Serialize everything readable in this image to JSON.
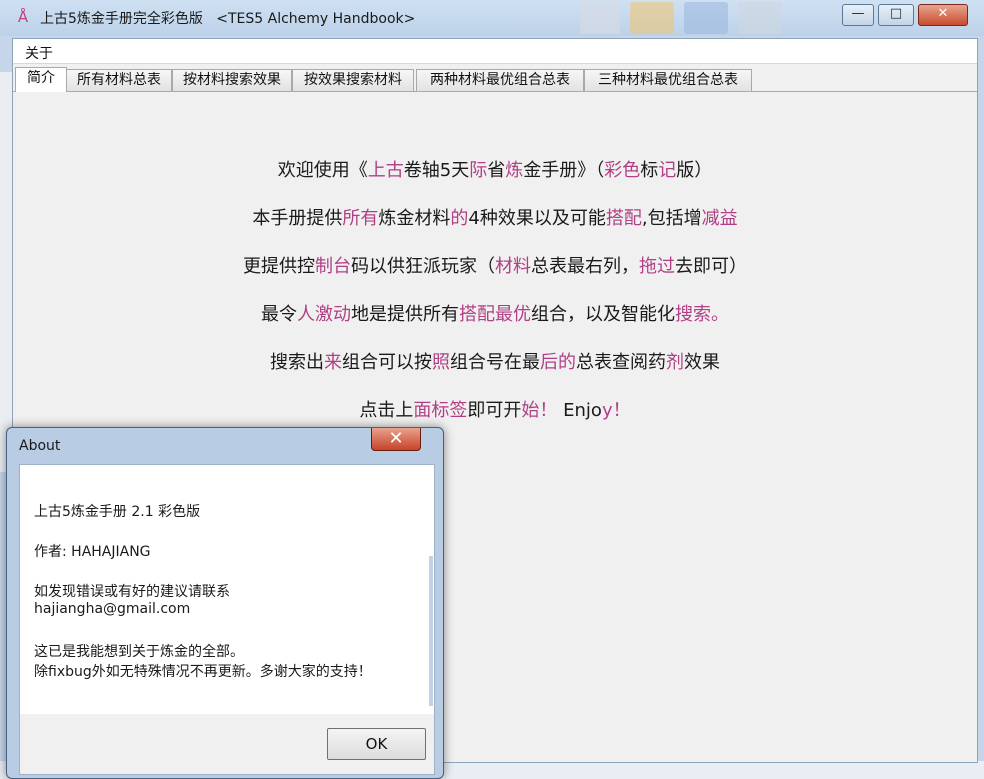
{
  "window": {
    "title": "上古5炼金手册完全彩色版   <TES5 Alchemy Handbook>",
    "min_icon": "minimize-icon",
    "max_icon": "maximize-icon",
    "close_icon": "close-icon",
    "accent": "#b03f85"
  },
  "menu": {
    "about": "关于"
  },
  "tabs": [
    {
      "label": "简介"
    },
    {
      "label": "所有材料总表"
    },
    {
      "label": "按材料搜索效果"
    },
    {
      "label": "按效果搜索材料"
    },
    {
      "label": "两种材料最优组合总表"
    },
    {
      "label": "三种材料最优组合总表"
    }
  ],
  "intro": {
    "l1a": "欢迎使用《",
    "l1b": "上古",
    "l1c": "卷轴5天",
    "l1d": "际",
    "l1e": "省",
    "l1f": "炼",
    "l1g": "金手册》（",
    "l1h": "彩色",
    "l1i": "标",
    "l1j": "记",
    "l1k": "版）",
    "l2a": "本手册提供",
    "l2b": "所有",
    "l2c": "炼",
    "l2d": "金材料",
    "l2e": "的",
    "l2f": "4种效果以及可能",
    "l2g": "搭配",
    "l2h": ",包括增",
    "l2i": "减益",
    "l3a": "更提供控",
    "l3b": "制",
    "l3c": "台",
    "l3d": "码以供狂派玩家（",
    "l3e": "材料",
    "l3f": "总表最右列，",
    "l3g": "拖过",
    "l3h": "去即可）",
    "l4a": "最令",
    "l4b": "人",
    "l4c": "激动",
    "l4d": "地是提供所有",
    "l4e": "搭配",
    "l4f": "最优",
    "l4g": "组合，以及智能化",
    "l4h": "搜索。",
    "l5a": "搜索出",
    "l5b": "来",
    "l5c": "组合可以按",
    "l5d": "照",
    "l5e": "组合号在最",
    "l5f": "后的",
    "l5g": "总表查阅药",
    "l5h": "剂",
    "l5i": "效果",
    "l6a": "点击上",
    "l6b": "面",
    "l6c": "标签",
    "l6d": "即可开",
    "l6e": "始！",
    "l6f": " Enjo",
    "l6g": "y",
    "l6h": "！"
  },
  "about_dialog": {
    "title": "About",
    "close_icon": "close-icon",
    "version": "上古5炼金手册 2.1 彩色版",
    "author": "作者: HAHAJIANG",
    "contact_line": "如发现错误或有好的建议请联系",
    "email": "hajiangha@gmail.com",
    "note1": "这已是我能想到关于炼金的全部。",
    "note2": "除fixbug外如无特殊情况不再更新。多谢大家的支持！",
    "ok_label": "OK"
  }
}
